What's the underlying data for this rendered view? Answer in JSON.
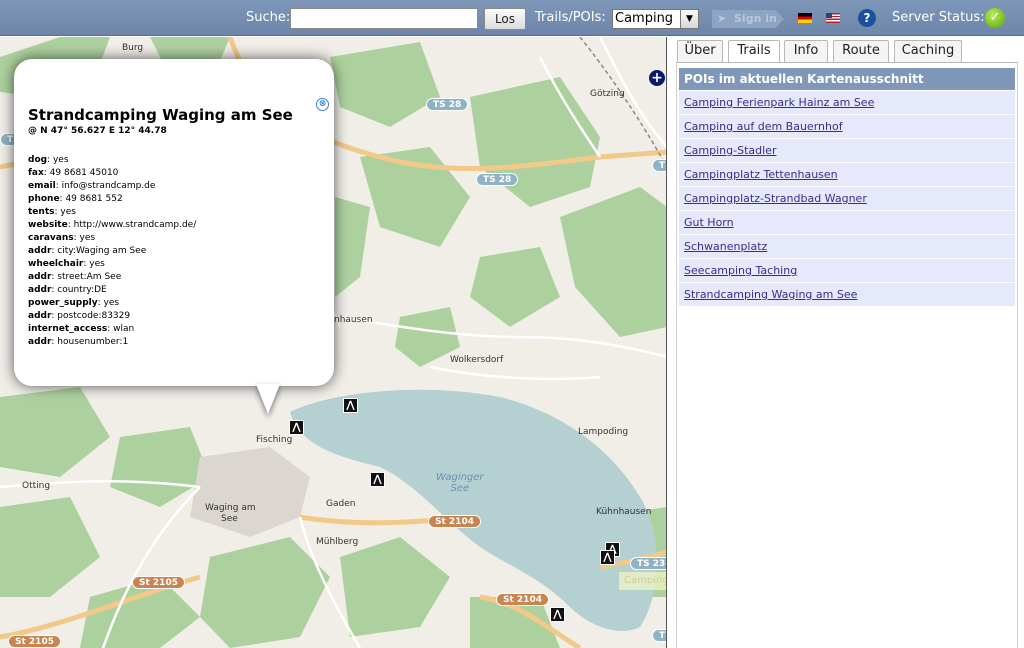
{
  "toolbar": {
    "search_label": "Suche:",
    "search_value": "",
    "search_button": "Los",
    "trails_label": "Trails/POIs:",
    "trails_selected": "Camping",
    "signin_label": "Sign in",
    "server_status_label": "Server Status:"
  },
  "icons": {
    "signin": "sign-in-arrow-icon",
    "flag_de": "german-flag-icon",
    "flag_us": "us-flag-icon",
    "help": "help-icon",
    "status": "check-ok-icon"
  },
  "map": {
    "place_labels": {
      "burg": "Burg",
      "goetzing": "Götzing",
      "hausen": "nhausen",
      "wolkersdorf": "Wolkersdorf",
      "lampoding": "Lampoding",
      "fisching": "Fisching",
      "otting": "Otting",
      "waging": "Waging am\nSee",
      "gaden": "Gaden",
      "kuehnhausen": "Kühnhausen",
      "muehlberg": "Mühlberg"
    },
    "lake_label": "Waginger\nSee",
    "road_labels": {
      "ts28_a": "TS 28",
      "ts28_b": "TS 28",
      "ts_left": "TS",
      "ts_right": "T",
      "ts23": "TS 23",
      "st2104_a": "St 2104",
      "st2104_b": "St 2104",
      "st2105_a": "St 2105",
      "st2105_b": "St 2105",
      "ts_bottom": "TS"
    },
    "zoom_plus": "+",
    "tooltip": "Camping-Stadler",
    "colors": {
      "land": "#f1eee8",
      "forest": "#add19e",
      "water": "#b5d0d0",
      "road_major": "#f8d59b",
      "road_minor": "#ffffff"
    }
  },
  "popup": {
    "title": "Strandcamping Waging am See",
    "coords": "@ N 47° 56.627 E 12° 44.78",
    "close": "⊗",
    "attributes": [
      {
        "key": "dog",
        "value": ": yes"
      },
      {
        "key": "fax",
        "value": ": 49 8681 45010"
      },
      {
        "key": "email",
        "value": ": info@strandcamp.de"
      },
      {
        "key": "phone",
        "value": ": 49 8681 552"
      },
      {
        "key": "tents",
        "value": ": yes"
      },
      {
        "key": "website",
        "value": ": http://www.strandcamp.de/"
      },
      {
        "key": "caravans",
        "value": ": yes"
      },
      {
        "key": "addr",
        "value": ": city:Waging am See"
      },
      {
        "key": "wheelchair",
        "value": ": yes"
      },
      {
        "key": "addr",
        "value": ": street:Am See"
      },
      {
        "key": "addr",
        "value": ": country:DE"
      },
      {
        "key": "power_supply",
        "value": ": yes"
      },
      {
        "key": "addr",
        "value": ": postcode:83329"
      },
      {
        "key": "internet_access",
        "value": ": wlan"
      },
      {
        "key": "addr",
        "value": ": housenumber:1"
      }
    ]
  },
  "panel": {
    "tabs": [
      {
        "label": "Über",
        "active": false
      },
      {
        "label": "Trails",
        "active": true
      },
      {
        "label": "Info",
        "active": false
      },
      {
        "label": "Route",
        "active": false
      },
      {
        "label": "Caching",
        "active": false
      }
    ],
    "header": "POIs im aktuellen Kartenausschnitt",
    "pois": [
      "Camping Ferienpark Hainz am See",
      "Camping auf dem Bauernhof",
      "Camping-Stadler",
      "Campingplatz Tettenhausen",
      "Campingplatz-Strandbad Wagner",
      "Gut Horn",
      "Schwanenplatz",
      "Seecamping Taching",
      "Strandcamping Waging am See"
    ]
  }
}
